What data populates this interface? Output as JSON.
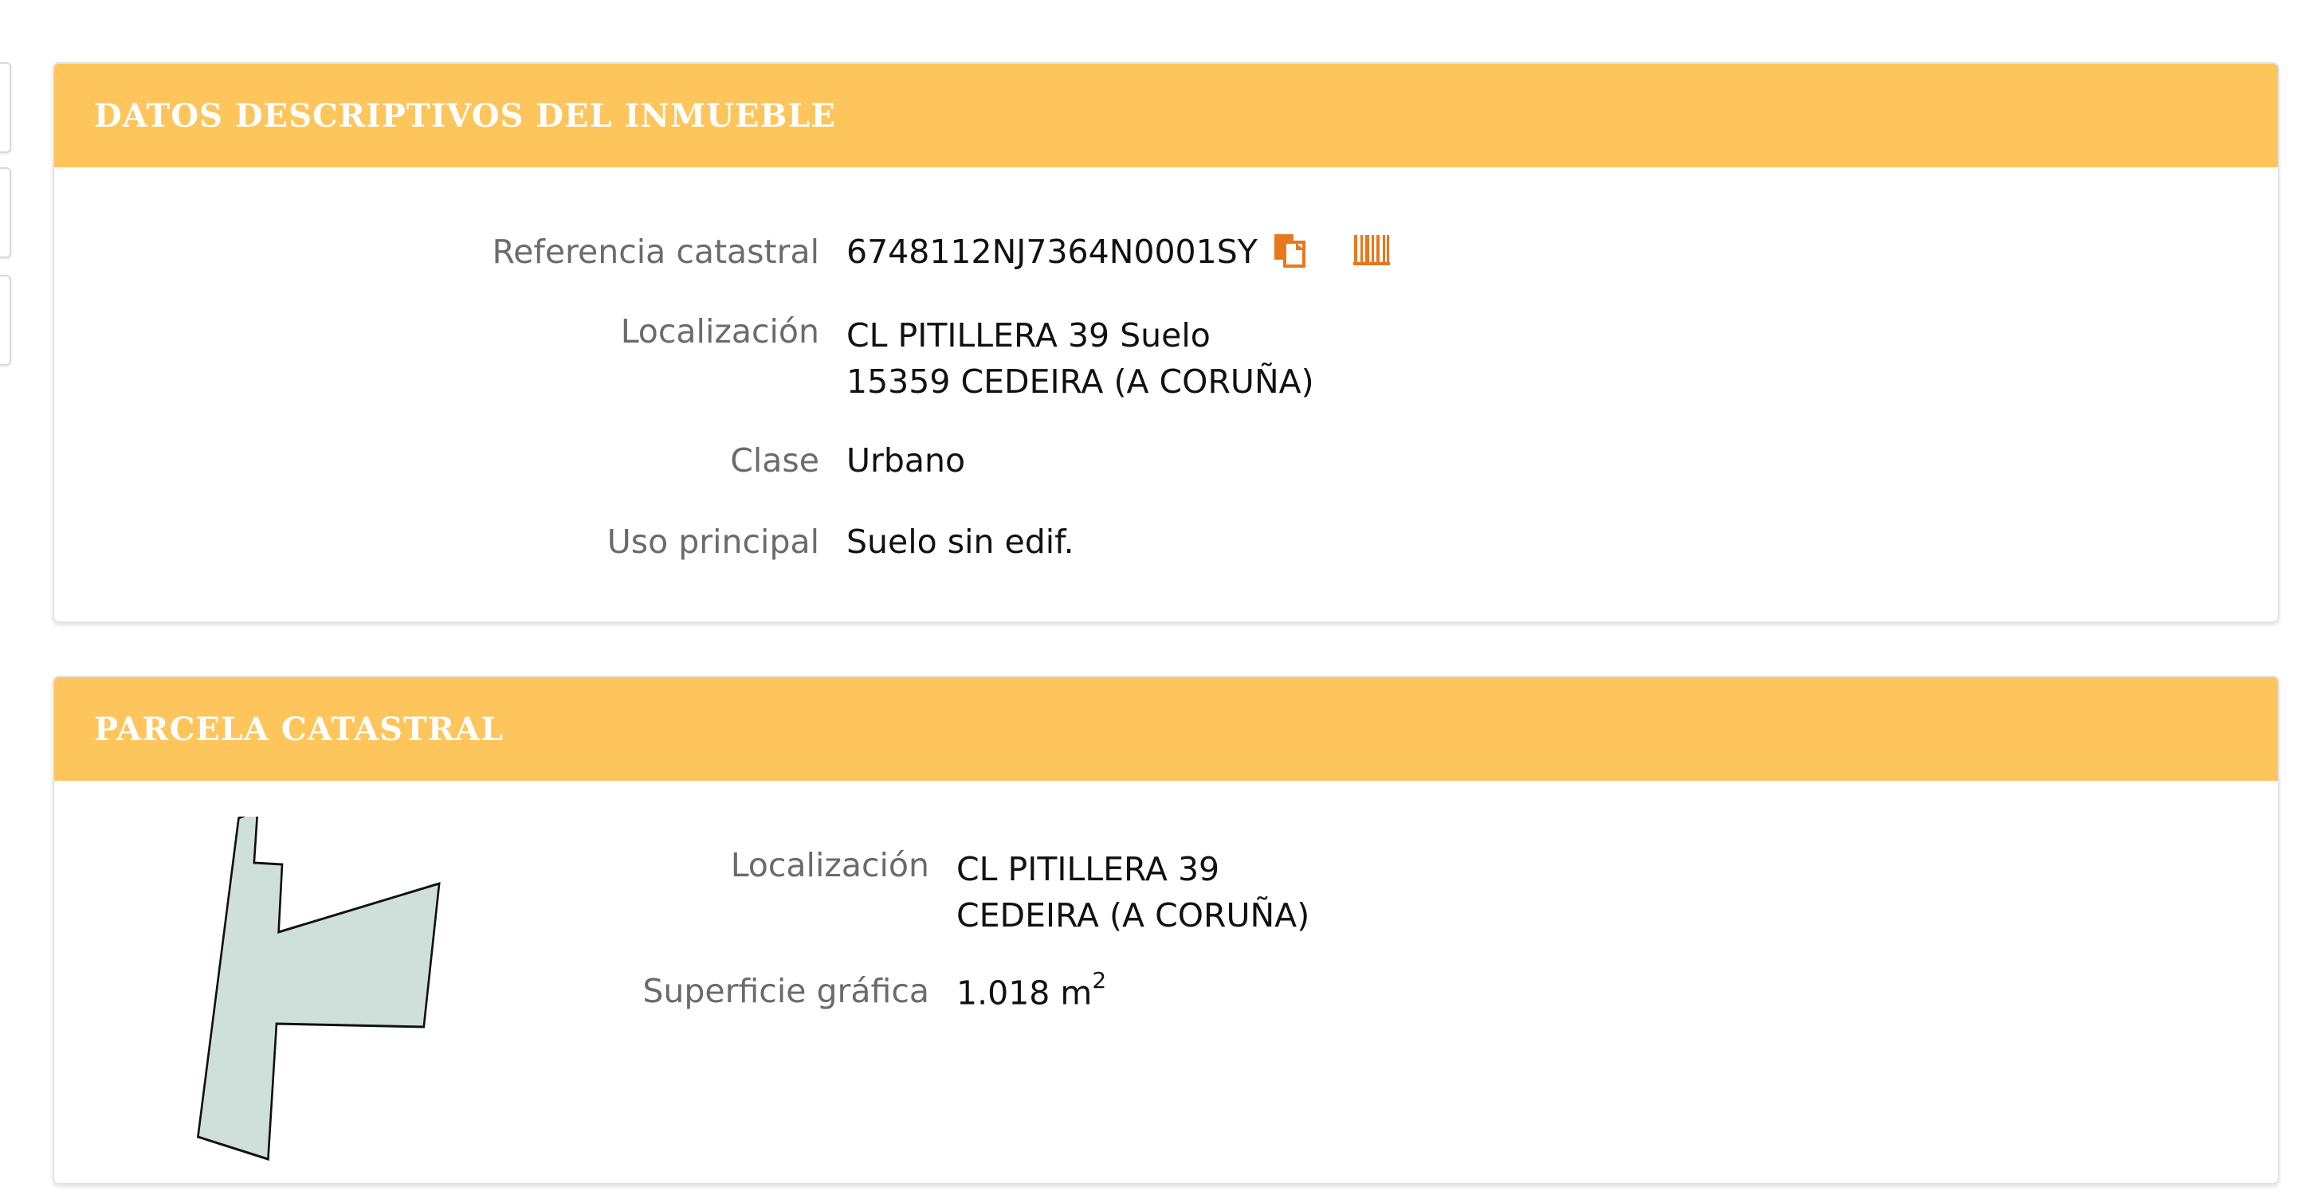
{
  "panels": {
    "descriptivos": {
      "title": "DATOS DESCRIPTIVOS DEL INMUEBLE",
      "fields": {
        "referencia_label": "Referencia catastral",
        "referencia_value": "6748112NJ7364N0001SY",
        "localizacion_label": "Localización",
        "localizacion_line1": "CL PITILLERA 39 Suelo",
        "localizacion_line2": "15359 CEDEIRA (A CORUÑA)",
        "clase_label": "Clase",
        "clase_value": "Urbano",
        "uso_label": "Uso principal",
        "uso_value": "Suelo sin edif."
      },
      "icons": [
        "copy-icon",
        "barcode-icon"
      ]
    },
    "parcela": {
      "title": "PARCELA CATASTRAL",
      "fields": {
        "localizacion_label": "Localización",
        "localizacion_line1": "CL PITILLERA 39",
        "localizacion_line2": "CEDEIRA (A CORUÑA)",
        "superficie_label": "Superficie gráfica",
        "superficie_value": "1.018 m",
        "superficie_unit_exp": "2"
      }
    }
  },
  "colors": {
    "header_bg": "#fdc55c",
    "icon_orange": "#e8781e",
    "parcel_fill": "#cfe0da"
  }
}
